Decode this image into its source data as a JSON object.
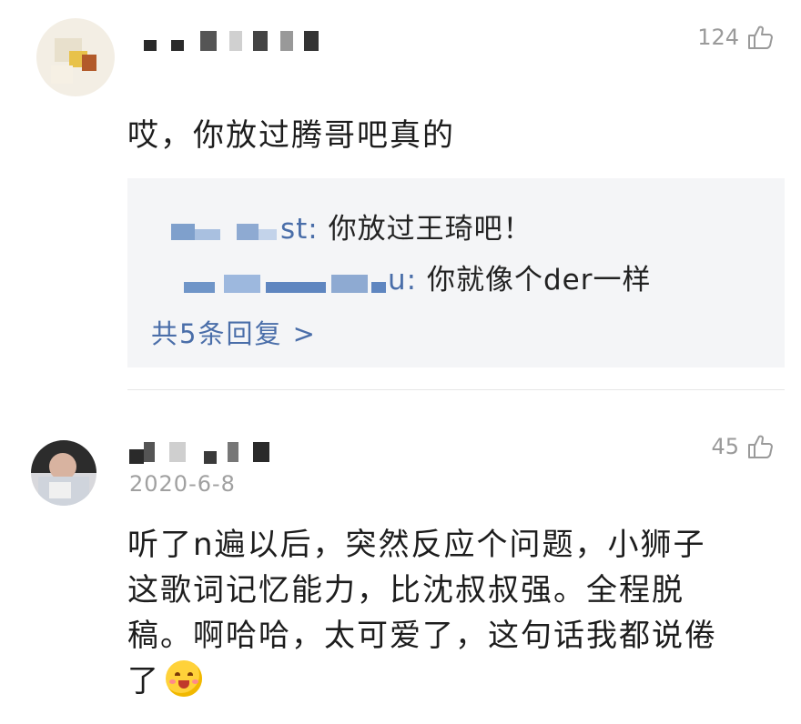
{
  "comments": [
    {
      "likes": "124",
      "text": "哎，你放过腾哥吧真的",
      "replies": [
        {
          "user_suffix": "st:",
          "text": "你放过王琦吧！"
        },
        {
          "user_suffix": "u:",
          "text": "你就像个der一样"
        }
      ],
      "more_replies": "共5条回复 >"
    },
    {
      "likes": "45",
      "date": "2020-6-8",
      "text_lines": [
        "听了n遍以后，突然反应个问题，小狮子",
        "这歌词记忆能力，比沈叔叔强。全程脱",
        "稿。啊哈哈，太可爱了，这句话我都说倦",
        "了"
      ]
    }
  ],
  "icons": {
    "like": "thumbs-up-icon",
    "emoji": "blush-smile-emoji-icon"
  },
  "colors": {
    "link": "#4a6ea9",
    "muted": "#9a9a9a",
    "reply_bg": "#f4f5f7"
  }
}
